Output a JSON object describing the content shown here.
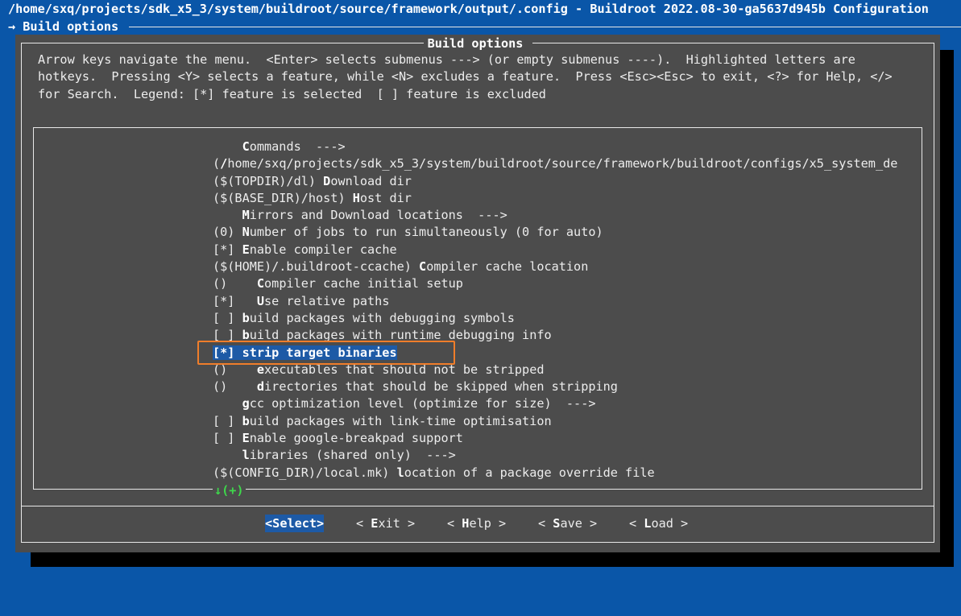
{
  "window": {
    "title": "/home/sxq/projects/sdk_x5_3/system/buildroot/source/framework/output/.config - Buildroot 2022.08-30-ga5637d945b Configuration",
    "breadcrumb": "→ Build options"
  },
  "dialog": {
    "title": "Build options",
    "help_lines": [
      "Arrow keys navigate the menu.  <Enter> selects submenus ---> (or empty submenus ----).  Highlighted letters are",
      "hotkeys.  Pressing <Y> selects a feature, while <N> excludes a feature.  Press <Esc><Esc> to exit, <?> for Help, </>",
      "for Search.  Legend: [*] feature is selected  [ ] feature is excluded"
    ],
    "more_indicator": "↓(+)"
  },
  "menu": {
    "items": [
      {
        "prefix": "    ",
        "hotkey": "C",
        "rest": "ommands  --->"
      },
      {
        "prefix": "(",
        "hotkey": "/",
        "rest": "home/sxq/projects/sdk_x5_3/system/buildroot/source/framework/buildroot/configs/x5_system_de"
      },
      {
        "prefix": "($(TOPDIR)/dl) ",
        "hotkey": "D",
        "rest": "ownload dir"
      },
      {
        "prefix": "($(BASE_DIR)/host) ",
        "hotkey": "H",
        "rest": "ost dir"
      },
      {
        "prefix": "    ",
        "hotkey": "M",
        "rest": "irrors and Download locations  --->"
      },
      {
        "prefix": "(0) ",
        "hotkey": "N",
        "rest": "umber of jobs to run simultaneously (0 for auto)"
      },
      {
        "prefix": "[*] ",
        "hotkey": "E",
        "rest": "nable compiler cache"
      },
      {
        "prefix": "($(HOME)/.buildroot-ccache) ",
        "hotkey": "C",
        "rest": "ompiler cache location"
      },
      {
        "prefix": "()    ",
        "hotkey": "C",
        "rest": "ompiler cache initial setup"
      },
      {
        "prefix": "[*]   ",
        "hotkey": "U",
        "rest": "se relative paths"
      },
      {
        "prefix": "[ ] ",
        "hotkey": "b",
        "rest": "uild packages with debugging symbols"
      },
      {
        "prefix": "[ ] ",
        "hotkey": "b",
        "rest": "uild packages with runtime debugging info"
      },
      {
        "prefix": "[*] ",
        "hotkey": "s",
        "rest": "trip target binaries",
        "selected": true
      },
      {
        "prefix": "()    ",
        "hotkey": "e",
        "rest": "xecutables that should not be stripped"
      },
      {
        "prefix": "()    ",
        "hotkey": "d",
        "rest": "irectories that should be skipped when stripping"
      },
      {
        "prefix": "    ",
        "hotkey": "g",
        "rest": "cc optimization level (optimize for size)  --->"
      },
      {
        "prefix": "[ ] ",
        "hotkey": "b",
        "rest": "uild packages with link-time optimisation"
      },
      {
        "prefix": "[ ] ",
        "hotkey": "E",
        "rest": "nable google-breakpad support"
      },
      {
        "prefix": "    ",
        "hotkey": "l",
        "rest": "ibraries (shared only)  --->"
      },
      {
        "prefix": "($(CONFIG_DIR)/local.mk) ",
        "hotkey": "l",
        "rest": "ocation of a package override file"
      }
    ]
  },
  "buttons": {
    "select": {
      "open": "<",
      "key": "S",
      "rest": "elect>"
    },
    "exit": {
      "open": "< ",
      "key": "E",
      "rest": "xit >"
    },
    "help": {
      "open": "< ",
      "key": "H",
      "rest": "elp >"
    },
    "save": {
      "open": "< ",
      "key": "S",
      "rest": "ave >"
    },
    "load": {
      "open": "< ",
      "key": "L",
      "rest": "oad >"
    }
  },
  "colors": {
    "background": "#0a56a8",
    "dialog": "#4c4c4c",
    "selection": "#1d5aa6",
    "highlight_box": "#f07d2a",
    "more_indicator": "#3ed84b"
  }
}
